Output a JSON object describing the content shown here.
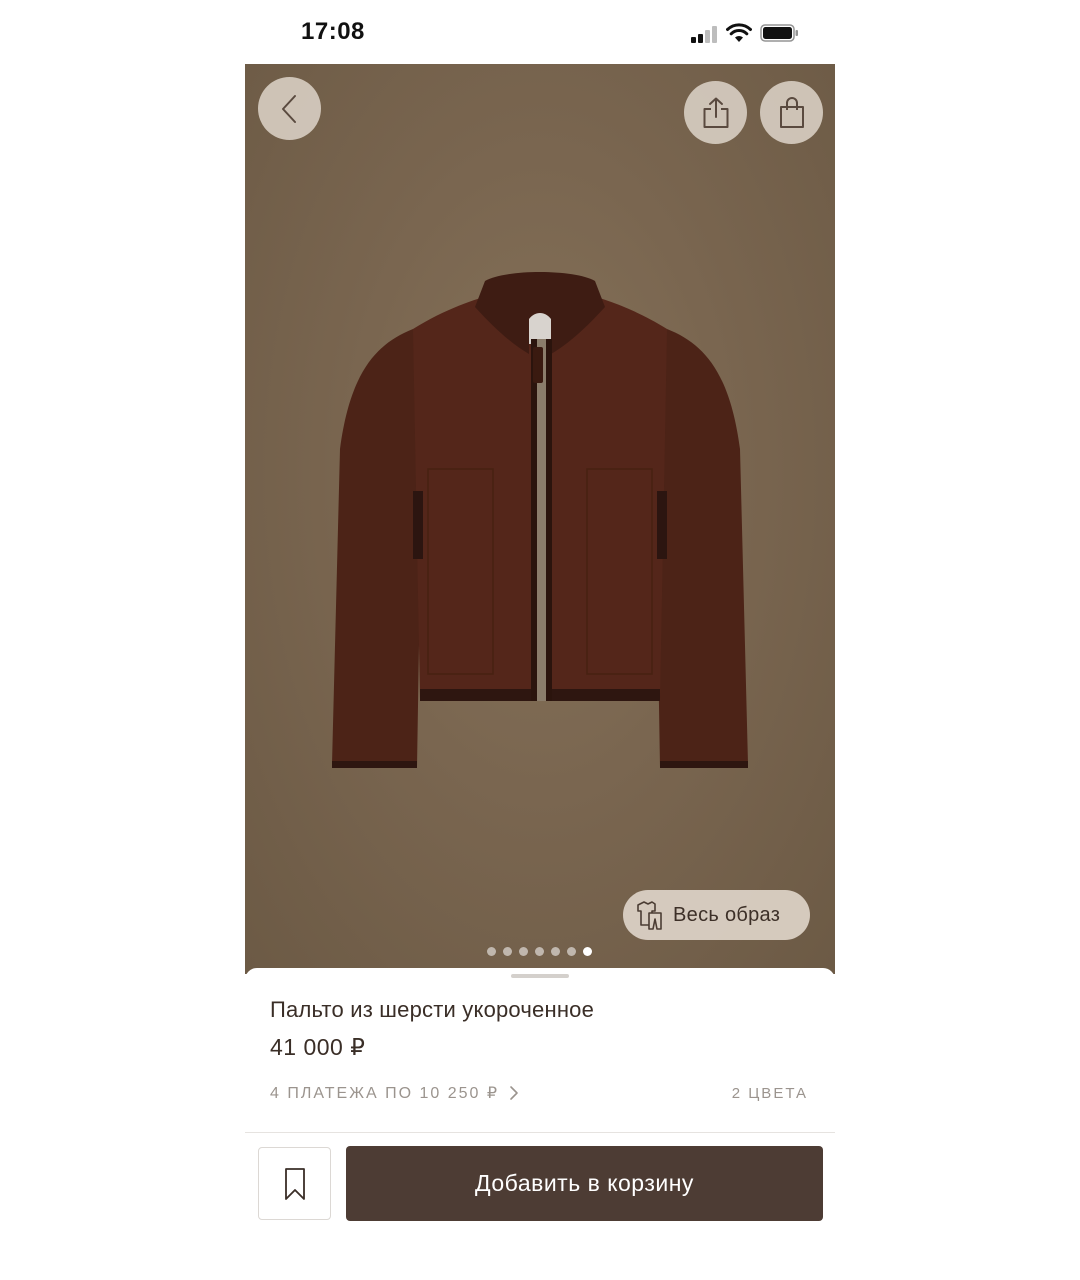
{
  "status_bar": {
    "time": "17:08"
  },
  "colors": {
    "hero_bg": "#7a6650",
    "cart_button": "#4d3c34",
    "text_primary": "#3a2e27",
    "text_muted": "#9b948e"
  },
  "hero": {
    "icons": {
      "back": "chevron-left-icon",
      "share": "share-icon",
      "bag": "shopping-bag-icon",
      "look": "outfit-icon"
    },
    "look_button_label": "Весь образ",
    "carousel": {
      "total": 7,
      "active_index": 6
    }
  },
  "product": {
    "title": "Пальто из шерсти укороченное",
    "price": "41 000 ₽",
    "installments_label": "4 ПЛАТЕЖА ПО 10 250 ₽",
    "colors_label": "2 ЦВЕТА"
  },
  "actions": {
    "favorite_icon": "bookmark-icon",
    "add_to_cart_label": "Добавить в корзину"
  }
}
